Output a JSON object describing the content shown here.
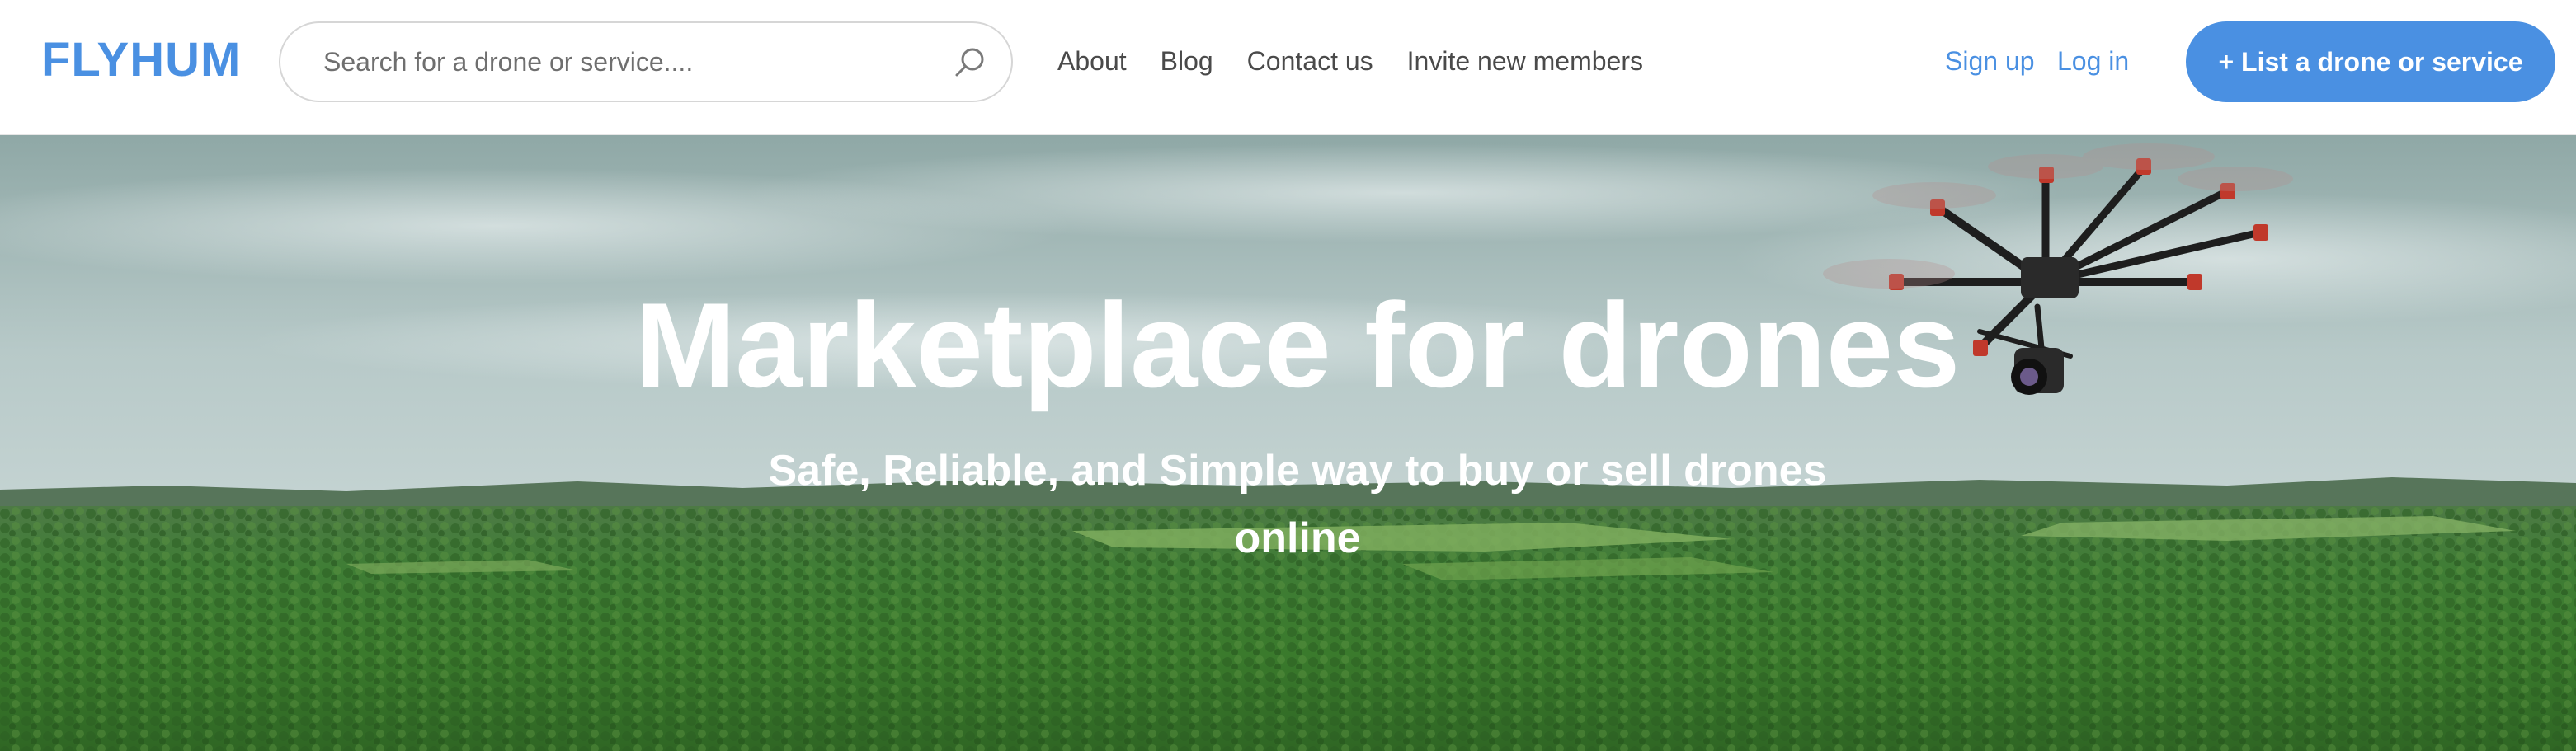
{
  "header": {
    "logo_text": "FLYHUM",
    "search": {
      "placeholder": "Search for a drone or service....",
      "value": "",
      "icon": "search-icon"
    },
    "nav": [
      {
        "label": "About"
      },
      {
        "label": "Blog"
      },
      {
        "label": "Contact us"
      },
      {
        "label": "Invite new members"
      }
    ],
    "signup_label": "Sign up",
    "login_label": "Log in",
    "cta_label": "+ List a drone or service"
  },
  "hero": {
    "title": "Marketplace for drones",
    "subtitle": "Safe, Reliable, and Simple way to buy or sell drones online",
    "image": "drone-over-forest"
  },
  "colors": {
    "brand": "#4a90e2",
    "text": "#4a4a4a",
    "border": "#d6d6d6",
    "hero_text": "#ffffff"
  }
}
